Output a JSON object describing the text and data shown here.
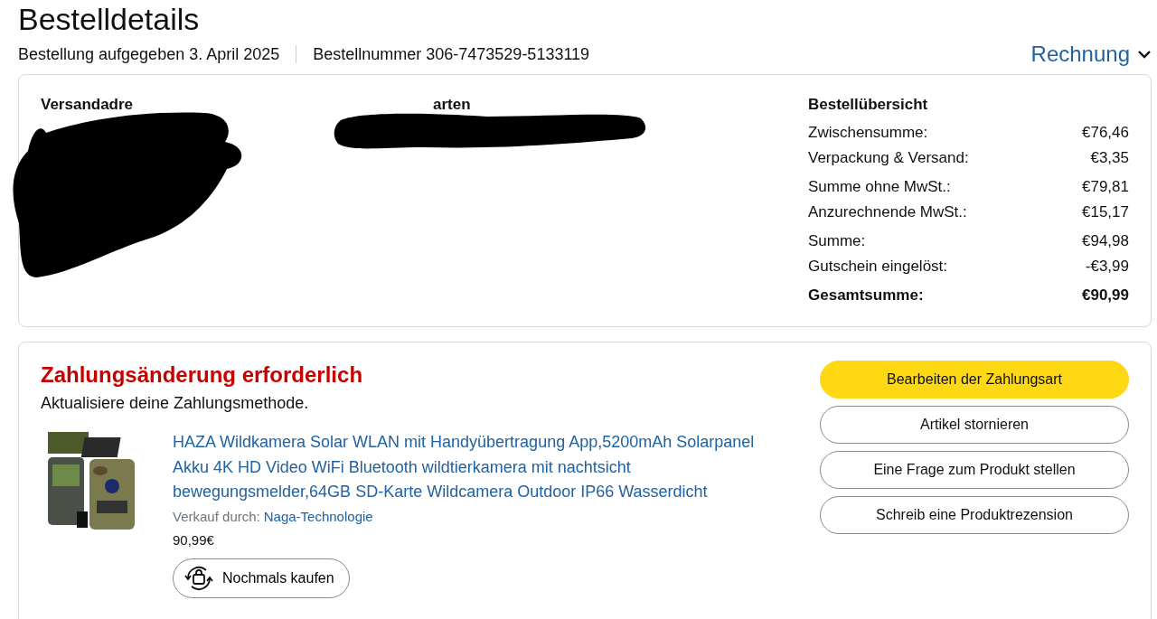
{
  "page_title": "Bestelldetails",
  "order_date": "Bestellung aufgegeben 3. April 2025",
  "order_number": "Bestellnummer 306-7473529-5133119",
  "invoice_link": "Rechnung",
  "shipping": {
    "heading": "Versandadre"
  },
  "payment": {
    "heading": "arten"
  },
  "summary": {
    "heading": "Bestellübersicht",
    "groups": [
      [
        {
          "label": "Zwischensumme:",
          "value": "€76,46",
          "kind": "line"
        },
        {
          "label": "Verpackung & Versand:",
          "value": "€3,35",
          "kind": "line"
        }
      ],
      [
        {
          "label": "Summe ohne MwSt.:",
          "value": "€79,81",
          "kind": "line"
        },
        {
          "label": "Anzurechnende MwSt.:",
          "value": "€15,17",
          "kind": "line"
        }
      ],
      [
        {
          "label": "Summe:",
          "value": "€94,98",
          "kind": "line"
        },
        {
          "label": "Gutschein eingelöst:",
          "value": "-€3,99",
          "kind": "line"
        }
      ],
      [
        {
          "label": "Gesamtsumme:",
          "value": "€90,99",
          "kind": "total"
        }
      ]
    ]
  },
  "notice": {
    "title": "Zahlungsänderung erforderlich",
    "text": "Aktualisiere deine Zahlungsmethode."
  },
  "item": {
    "title": "HAZA Wildkamera Solar WLAN mit Handyübertragung App,5200mAh Solarpanel Akku 4K HD Video WiFi Bluetooth wildtierkamera mit nachtsicht bewegungsmelder,64GB SD-Karte Wildcamera Outdoor IP66 Wasserdicht",
    "seller_label": "Verkauf durch:",
    "seller": "Naga-Technologie",
    "price": "90,99€",
    "buy_again": "Nochmals kaufen"
  },
  "actions": [
    {
      "label": "Bearbeiten der Zahlungsart",
      "kind": "primary"
    },
    {
      "label": "Artikel stornieren",
      "kind": "secondary"
    },
    {
      "label": "Eine Frage zum Produkt stellen",
      "kind": "secondary"
    },
    {
      "label": "Schreib eine Produktrezension",
      "kind": "secondary"
    }
  ]
}
